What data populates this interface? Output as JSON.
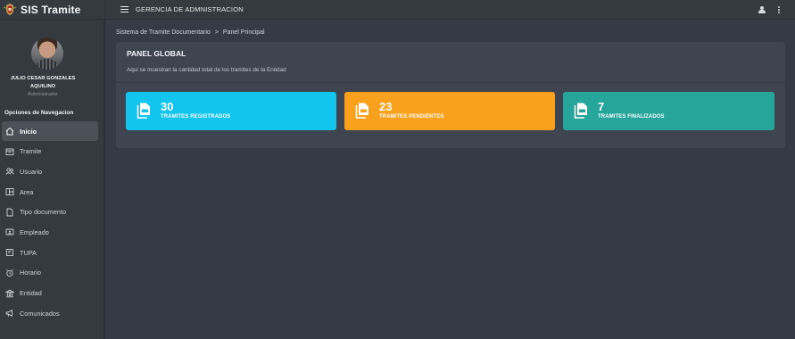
{
  "app": {
    "brand": "SIS Tramite",
    "title": "GERENCIA DE ADMNISTRACION"
  },
  "user": {
    "name": "JULIO CESAR GONZALES AQUILINO",
    "role": "Administrador"
  },
  "sidebar": {
    "heading": "Opciones de Navegacion",
    "items": [
      {
        "label": "Inicio",
        "icon": "home-icon",
        "active": true
      },
      {
        "label": "Tramite",
        "icon": "inbox-icon"
      },
      {
        "label": "Usuario",
        "icon": "users-icon"
      },
      {
        "label": "Area",
        "icon": "area-icon"
      },
      {
        "label": "Tipo documento",
        "icon": "document-icon"
      },
      {
        "label": "Empleado",
        "icon": "id-card-icon"
      },
      {
        "label": "TUPA",
        "icon": "tupa-icon"
      },
      {
        "label": "Horario",
        "icon": "alarm-clock-icon"
      },
      {
        "label": "Entidad",
        "icon": "bank-icon"
      },
      {
        "label": "Comunicados",
        "icon": "megaphone-icon"
      }
    ]
  },
  "breadcrumb": {
    "parent": "Sistema de Tramite Documentario",
    "separator": ">",
    "current": "Panel Principal"
  },
  "panel": {
    "title": "PANEL GLOBAL",
    "subtitle": "Aqui se muestran la cantidad total de los tramites de la Entidad",
    "cards": [
      {
        "count": "30",
        "label": "TRAMITES REGISTRADOS",
        "color": "#11c5ee",
        "icon": "document-stack-icon"
      },
      {
        "count": "23",
        "label": "TRAMITES PENDIENTES",
        "color": "#f9a11c",
        "icon": "document-stack-icon"
      },
      {
        "count": "7",
        "label": "TRAMITES FINALIZADOS",
        "color": "#26a69a",
        "icon": "document-stack-icon"
      }
    ]
  }
}
